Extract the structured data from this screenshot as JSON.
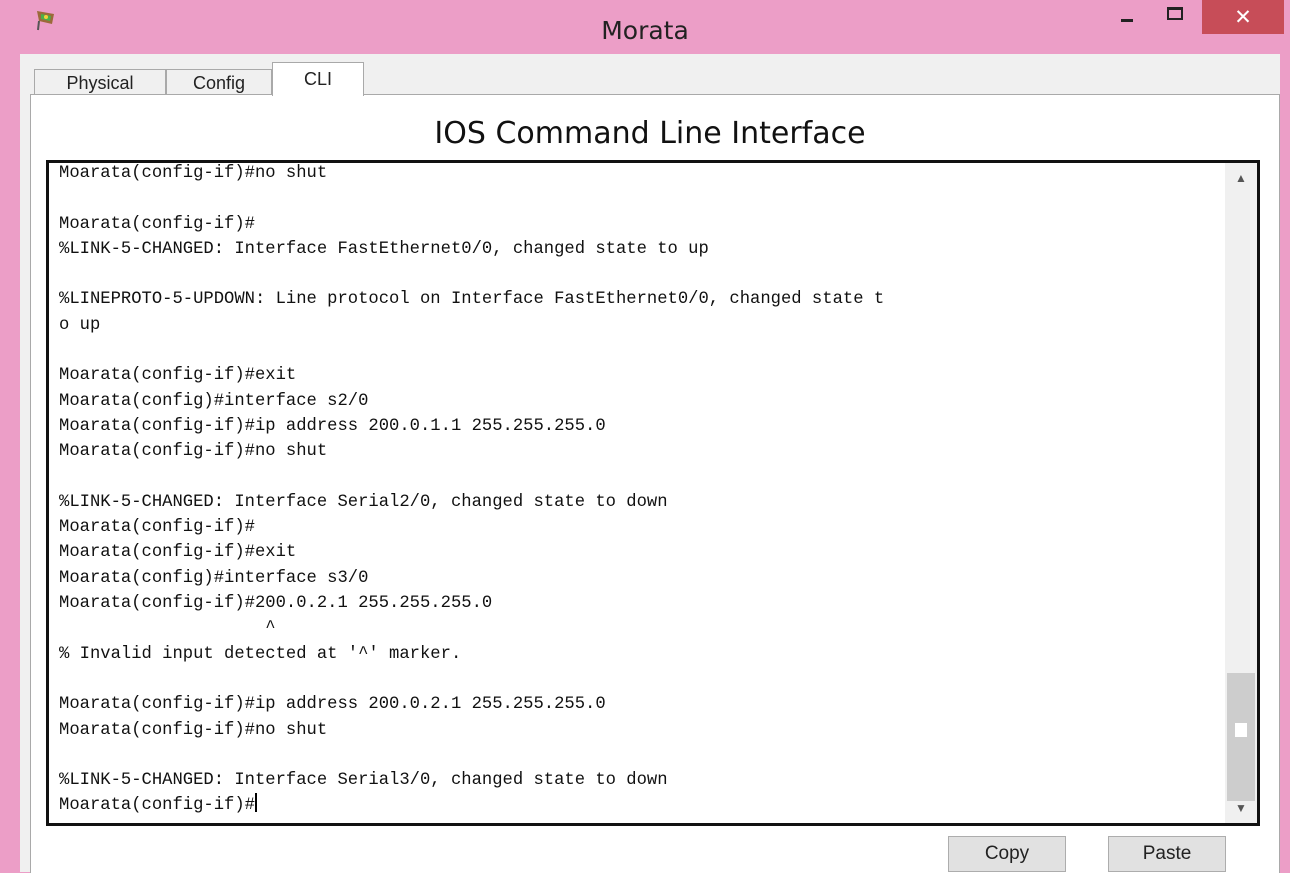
{
  "window": {
    "title": "Morata",
    "icon": "packet-tracer-router-icon",
    "close_glyph": "✕"
  },
  "tabs": [
    {
      "label": "Physical",
      "active": false
    },
    {
      "label": "Config",
      "active": false
    },
    {
      "label": "CLI",
      "active": true
    }
  ],
  "cli": {
    "heading": "IOS Command Line Interface",
    "lines": [
      "Moarata(config-if)#no shut",
      "",
      "Moarata(config-if)#",
      "%LINK-5-CHANGED: Interface FastEthernet0/0, changed state to up",
      "",
      "%LINEPROTO-5-UPDOWN: Line protocol on Interface FastEthernet0/0, changed state t",
      "o up",
      "",
      "Moarata(config-if)#exit",
      "Moarata(config)#interface s2/0",
      "Moarata(config-if)#ip address 200.0.1.1 255.255.255.0",
      "Moarata(config-if)#no shut",
      "",
      "%LINK-5-CHANGED: Interface Serial2/0, changed state to down",
      "Moarata(config-if)#",
      "Moarata(config-if)#exit",
      "Moarata(config)#interface s3/0",
      "Moarata(config-if)#200.0.2.1 255.255.255.0",
      "                    ^",
      "% Invalid input detected at '^' marker.",
      "",
      "Moarata(config-if)#ip address 200.0.2.1 255.255.255.0",
      "Moarata(config-if)#no shut",
      "",
      "%LINK-5-CHANGED: Interface Serial3/0, changed state to down"
    ],
    "prompt": "Moarata(config-if)#"
  },
  "buttons": {
    "copy": "Copy",
    "paste": "Paste"
  },
  "colors": {
    "window_frame": "#ec9ec7",
    "close_button": "#c74d58"
  }
}
